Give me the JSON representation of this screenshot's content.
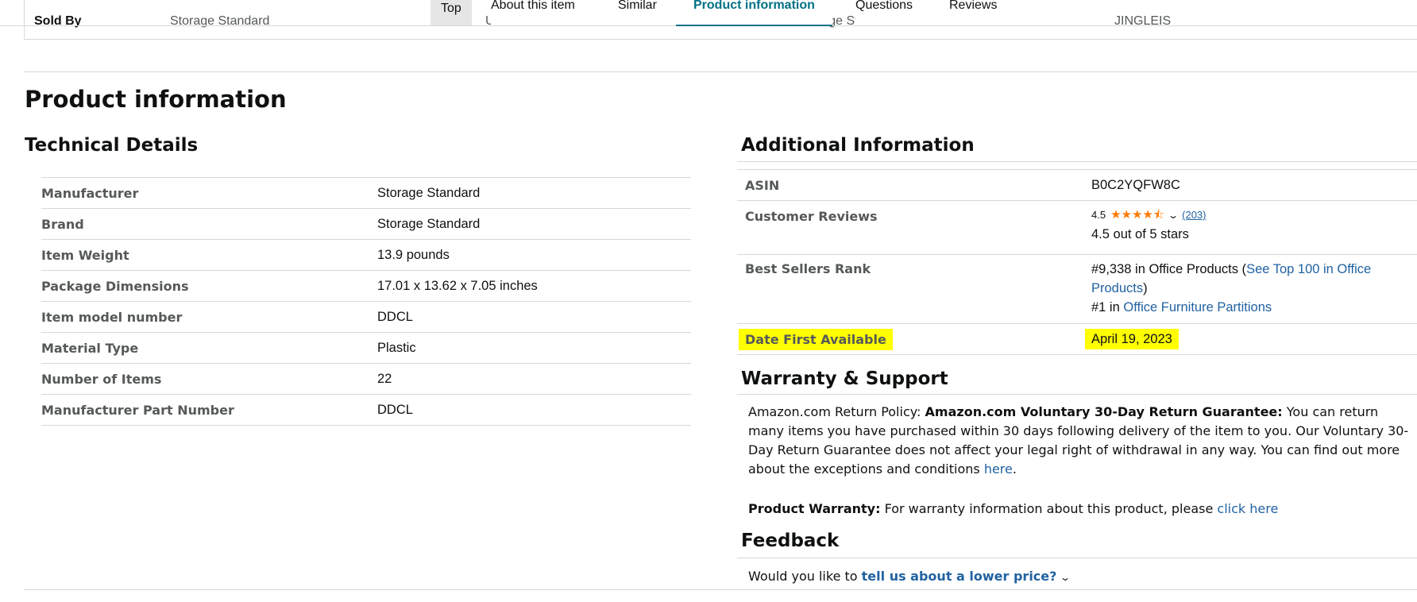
{
  "nav": {
    "tabs": [
      {
        "label": "Top"
      },
      {
        "label": "About this item"
      },
      {
        "label": "Similar"
      },
      {
        "label": "Product information"
      },
      {
        "label": "Questions"
      },
      {
        "label": "Reviews"
      }
    ],
    "active_tab": "Product information"
  },
  "comparison_row": {
    "label": "Sold By",
    "values": [
      "Storage Standard",
      "Ubeirt Direct",
      "Storage Standard",
      "JINGLEIS"
    ]
  },
  "page_title": "Product information",
  "technical_details": {
    "title": "Technical Details",
    "rows": [
      {
        "key": "Manufacturer",
        "value": "Storage Standard"
      },
      {
        "key": "Brand",
        "value": "Storage Standard"
      },
      {
        "key": "Item Weight",
        "value": "13.9 pounds"
      },
      {
        "key": "Package Dimensions",
        "value": "17.01 x 13.62 x 7.05 inches"
      },
      {
        "key": "Item model number",
        "value": "DDCL"
      },
      {
        "key": "Material Type",
        "value": "Plastic"
      },
      {
        "key": "Number of Items",
        "value": "22"
      },
      {
        "key": "Manufacturer Part Number",
        "value": "DDCL"
      }
    ]
  },
  "additional_information": {
    "title": "Additional Information",
    "asin": {
      "key": "ASIN",
      "value": "B0C2YQFW8C"
    },
    "reviews": {
      "key": "Customer Reviews",
      "rating": "4.5",
      "stars": "★★★★⯪",
      "count": "(203)",
      "text": "4.5 out of 5 stars"
    },
    "best_sellers": {
      "key": "Best Sellers Rank",
      "rank1_prefix": "#9,338 in Office Products (",
      "rank1_link": "See Top 100 in Office Products",
      "rank1_suffix": ")",
      "rank2_prefix": "#1 in ",
      "rank2_link": "Office Furniture Partitions"
    },
    "date_first": {
      "key": "Date First Available",
      "value": "April 19, 2023"
    },
    "highlight_color": "#ffff00"
  },
  "warranty": {
    "title": "Warranty & Support",
    "policy_label": "Amazon.com Return Policy:",
    "policy_bold": "Amazon.com Voluntary 30-Day Return Guarantee:",
    "policy_text": "You can return many items you have purchased within 30 days following delivery of the item to you. Our Voluntary 30-Day Return Guarantee does not affect your legal right of withdrawal in any way. You can find out more about the exceptions and conditions",
    "policy_link": "here",
    "policy_end": ".",
    "product_warranty_label": "Product Warranty:",
    "product_warranty_text": "For warranty information about this product, please",
    "product_warranty_link": "click here"
  },
  "feedback": {
    "title": "Feedback",
    "prompt": "Would you like to",
    "link": "tell us about a lower price?"
  },
  "colors": {
    "link": "#2162a1",
    "active_tab": "#007185",
    "star": "#ff7a00"
  }
}
